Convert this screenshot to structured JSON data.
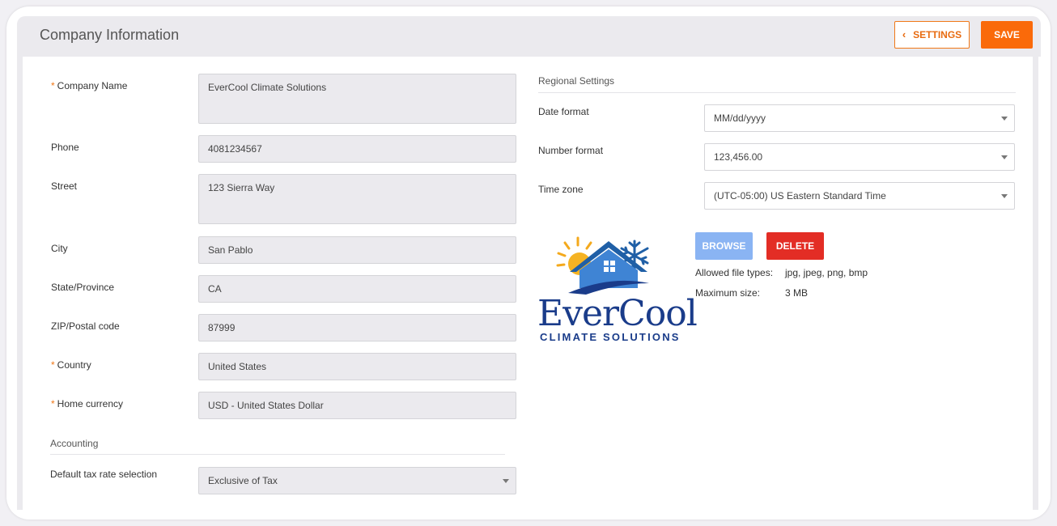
{
  "header": {
    "title": "Company Information",
    "settings_label": "SETTINGS",
    "save_label": "SAVE"
  },
  "form": {
    "company_name": {
      "label": "Company Name",
      "value": "EverCool Climate Solutions"
    },
    "phone": {
      "label": "Phone",
      "value": "4081234567"
    },
    "street": {
      "label": "Street",
      "value": "123 Sierra Way"
    },
    "city": {
      "label": "City",
      "value": "San Pablo"
    },
    "state": {
      "label": "State/Province",
      "value": "CA"
    },
    "zip": {
      "label": "ZIP/Postal code",
      "value": "87999"
    },
    "country": {
      "label": "Country",
      "value": "United States"
    },
    "home_currency": {
      "label": "Home currency",
      "value": "USD - United States Dollar"
    },
    "required_marker": "*"
  },
  "accounting": {
    "title": "Accounting",
    "tax_label": "Default tax rate selection",
    "tax_value": "Exclusive of Tax"
  },
  "regional": {
    "title": "Regional Settings",
    "date_format_label": "Date format",
    "date_format_value": "MM/dd/yyyy",
    "number_format_label": "Number format",
    "number_format_value": "123,456.00",
    "time_zone_label": "Time zone",
    "time_zone_value": "(UTC-05:00) US Eastern Standard Time"
  },
  "logo_upload": {
    "browse_label": "BROWSE",
    "delete_label": "DELETE",
    "allowed_types_label": "Allowed file types:",
    "allowed_types_value": "jpg, jpeg, png, bmp",
    "max_size_label": "Maximum size:",
    "max_size_value": "3 MB",
    "logo_text_main": "EverCool",
    "logo_text_sub": "CLIMATE SOLUTIONS"
  },
  "colors": {
    "accent": "#fa6a0a",
    "browse": "#8ab4f3",
    "delete": "#e32d25",
    "logo_blue": "#1a3c8a"
  },
  "icons": {
    "settings_back": "chevron-left-icon",
    "select_caret": "caret-down-icon"
  }
}
